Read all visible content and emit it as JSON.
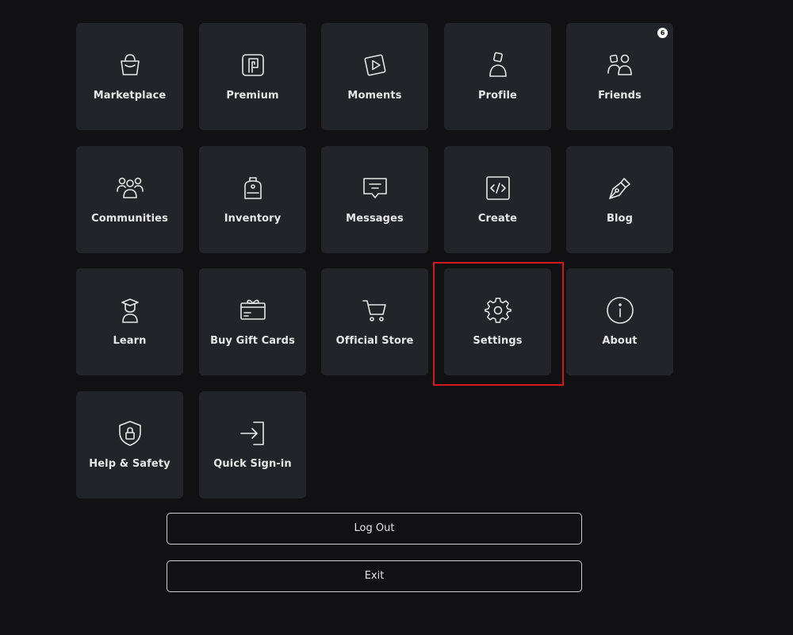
{
  "menu": {
    "tiles": [
      {
        "label": "Marketplace",
        "icon": "shopping-bag-icon"
      },
      {
        "label": "Premium",
        "icon": "premium-icon"
      },
      {
        "label": "Moments",
        "icon": "moments-play-icon"
      },
      {
        "label": "Profile",
        "icon": "profile-icon"
      },
      {
        "label": "Friends",
        "icon": "friends-icon",
        "badge": "6"
      },
      {
        "label": "Communities",
        "icon": "communities-icon"
      },
      {
        "label": "Inventory",
        "icon": "backpack-icon"
      },
      {
        "label": "Messages",
        "icon": "message-bubble-icon"
      },
      {
        "label": "Create",
        "icon": "code-icon"
      },
      {
        "label": "Blog",
        "icon": "pen-nib-icon"
      },
      {
        "label": "Learn",
        "icon": "graduate-icon"
      },
      {
        "label": "Buy Gift Cards",
        "icon": "gift-card-icon"
      },
      {
        "label": "Official Store",
        "icon": "shopping-cart-icon"
      },
      {
        "label": "Settings",
        "icon": "gear-icon"
      },
      {
        "label": "About",
        "icon": "info-icon"
      },
      {
        "label": "Help & Safety",
        "icon": "shield-lock-icon"
      },
      {
        "label": "Quick Sign-in",
        "icon": "sign-in-icon"
      }
    ]
  },
  "actions": {
    "logout_label": "Log Out",
    "exit_label": "Exit"
  },
  "colors": {
    "background": "#111114",
    "tile": "#232429",
    "text": "#e6e6e8",
    "highlight": "#d11a1a"
  }
}
